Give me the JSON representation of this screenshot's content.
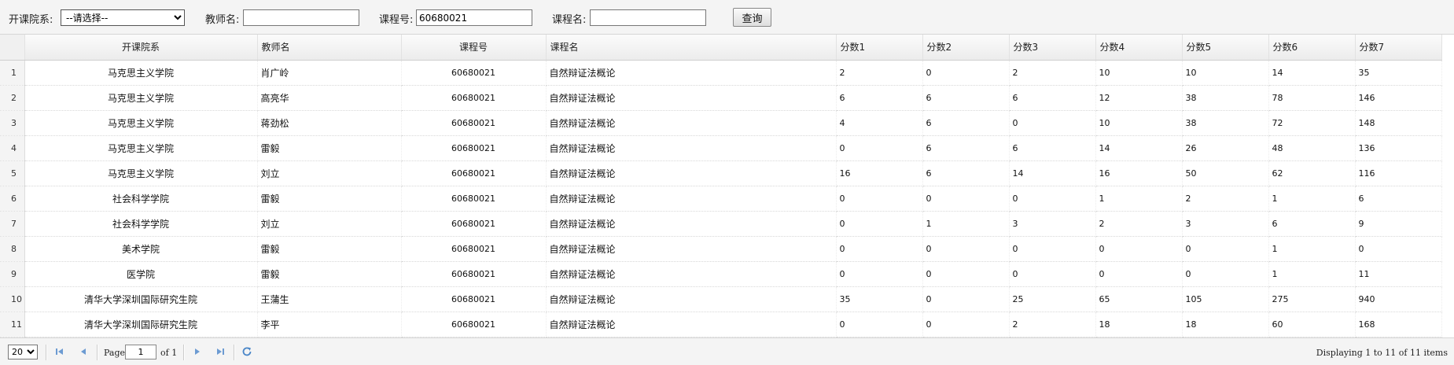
{
  "filters": {
    "dept_label": "开课院系:",
    "dept_value": "--请选择--",
    "teacher_label": "教师名:",
    "teacher_value": "",
    "course_no_label": "课程号:",
    "course_no_value": "60680021",
    "course_name_label": "课程名:",
    "course_name_value": "",
    "query_label": "查询"
  },
  "table": {
    "columns": [
      "开课院系",
      "教师名",
      "课程号",
      "课程名",
      "分数1",
      "分数2",
      "分数3",
      "分数4",
      "分数5",
      "分数6",
      "分数7"
    ],
    "rows": [
      {
        "n": "1",
        "dept": "马克思主义学院",
        "teacher": "肖广岭",
        "course_no": "60680021",
        "course_name": "自然辩证法概论",
        "s": [
          "2",
          "0",
          "2",
          "10",
          "10",
          "14",
          "35"
        ]
      },
      {
        "n": "2",
        "dept": "马克思主义学院",
        "teacher": "高亮华",
        "course_no": "60680021",
        "course_name": "自然辩证法概论",
        "s": [
          "6",
          "6",
          "6",
          "12",
          "38",
          "78",
          "146"
        ]
      },
      {
        "n": "3",
        "dept": "马克思主义学院",
        "teacher": "蒋劲松",
        "course_no": "60680021",
        "course_name": "自然辩证法概论",
        "s": [
          "4",
          "6",
          "0",
          "10",
          "38",
          "72",
          "148"
        ]
      },
      {
        "n": "4",
        "dept": "马克思主义学院",
        "teacher": "雷毅",
        "course_no": "60680021",
        "course_name": "自然辩证法概论",
        "s": [
          "0",
          "6",
          "6",
          "14",
          "26",
          "48",
          "136"
        ]
      },
      {
        "n": "5",
        "dept": "马克思主义学院",
        "teacher": "刘立",
        "course_no": "60680021",
        "course_name": "自然辩证法概论",
        "s": [
          "16",
          "6",
          "14",
          "16",
          "50",
          "62",
          "116"
        ]
      },
      {
        "n": "6",
        "dept": "社会科学学院",
        "teacher": "雷毅",
        "course_no": "60680021",
        "course_name": "自然辩证法概论",
        "s": [
          "0",
          "0",
          "0",
          "1",
          "2",
          "1",
          "6"
        ]
      },
      {
        "n": "7",
        "dept": "社会科学学院",
        "teacher": "刘立",
        "course_no": "60680021",
        "course_name": "自然辩证法概论",
        "s": [
          "0",
          "1",
          "3",
          "2",
          "3",
          "6",
          "9"
        ]
      },
      {
        "n": "8",
        "dept": "美术学院",
        "teacher": "雷毅",
        "course_no": "60680021",
        "course_name": "自然辩证法概论",
        "s": [
          "0",
          "0",
          "0",
          "0",
          "0",
          "1",
          "0"
        ]
      },
      {
        "n": "9",
        "dept": "医学院",
        "teacher": "雷毅",
        "course_no": "60680021",
        "course_name": "自然辩证法概论",
        "s": [
          "0",
          "0",
          "0",
          "0",
          "0",
          "1",
          "11"
        ]
      },
      {
        "n": "10",
        "dept": "清华大学深圳国际研究生院",
        "teacher": "王蒲生",
        "course_no": "60680021",
        "course_name": "自然辩证法概论",
        "s": [
          "35",
          "0",
          "25",
          "65",
          "105",
          "275",
          "940"
        ]
      },
      {
        "n": "11",
        "dept": "清华大学深圳国际研究生院",
        "teacher": "李平",
        "course_no": "60680021",
        "course_name": "自然辩证法概论",
        "s": [
          "0",
          "0",
          "2",
          "18",
          "18",
          "60",
          "168"
        ]
      }
    ]
  },
  "pager": {
    "page_size": "20",
    "page_label": "Page",
    "page_value": "1",
    "of_label": "of 1",
    "display_text": "Displaying 1 to 11 of 11 items"
  },
  "icons": {
    "first": "first-page-icon",
    "prev": "prev-page-icon",
    "next": "next-page-icon",
    "last": "last-page-icon",
    "refresh": "refresh-icon"
  },
  "colors": {
    "pager_icon": "#6c9bd2",
    "refresh_icon": "#4a86c8"
  }
}
